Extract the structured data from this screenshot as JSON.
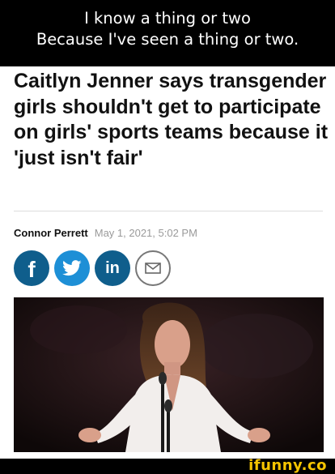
{
  "meme": {
    "caption_line1": "I know a thing or two",
    "caption_line2": "Because I've seen a thing or two.",
    "watermark": "ifunny.co"
  },
  "article": {
    "headline": "Caitlyn Jenner says transgender girls shouldn't get to participate on girls' sports teams because it 'just isn't fair'",
    "author": "Connor Perrett",
    "date": "May 1, 2021, 5:02 PM",
    "share": {
      "facebook_label": "f",
      "twitter_icon": "twitter-bird-icon",
      "linkedin_label": "in",
      "email_icon": "envelope-icon"
    },
    "colors": {
      "facebook": "#0f5e8c",
      "twitter": "#1d8fd6",
      "linkedin": "#0f5e8c",
      "watermark": "#f5c400"
    }
  }
}
